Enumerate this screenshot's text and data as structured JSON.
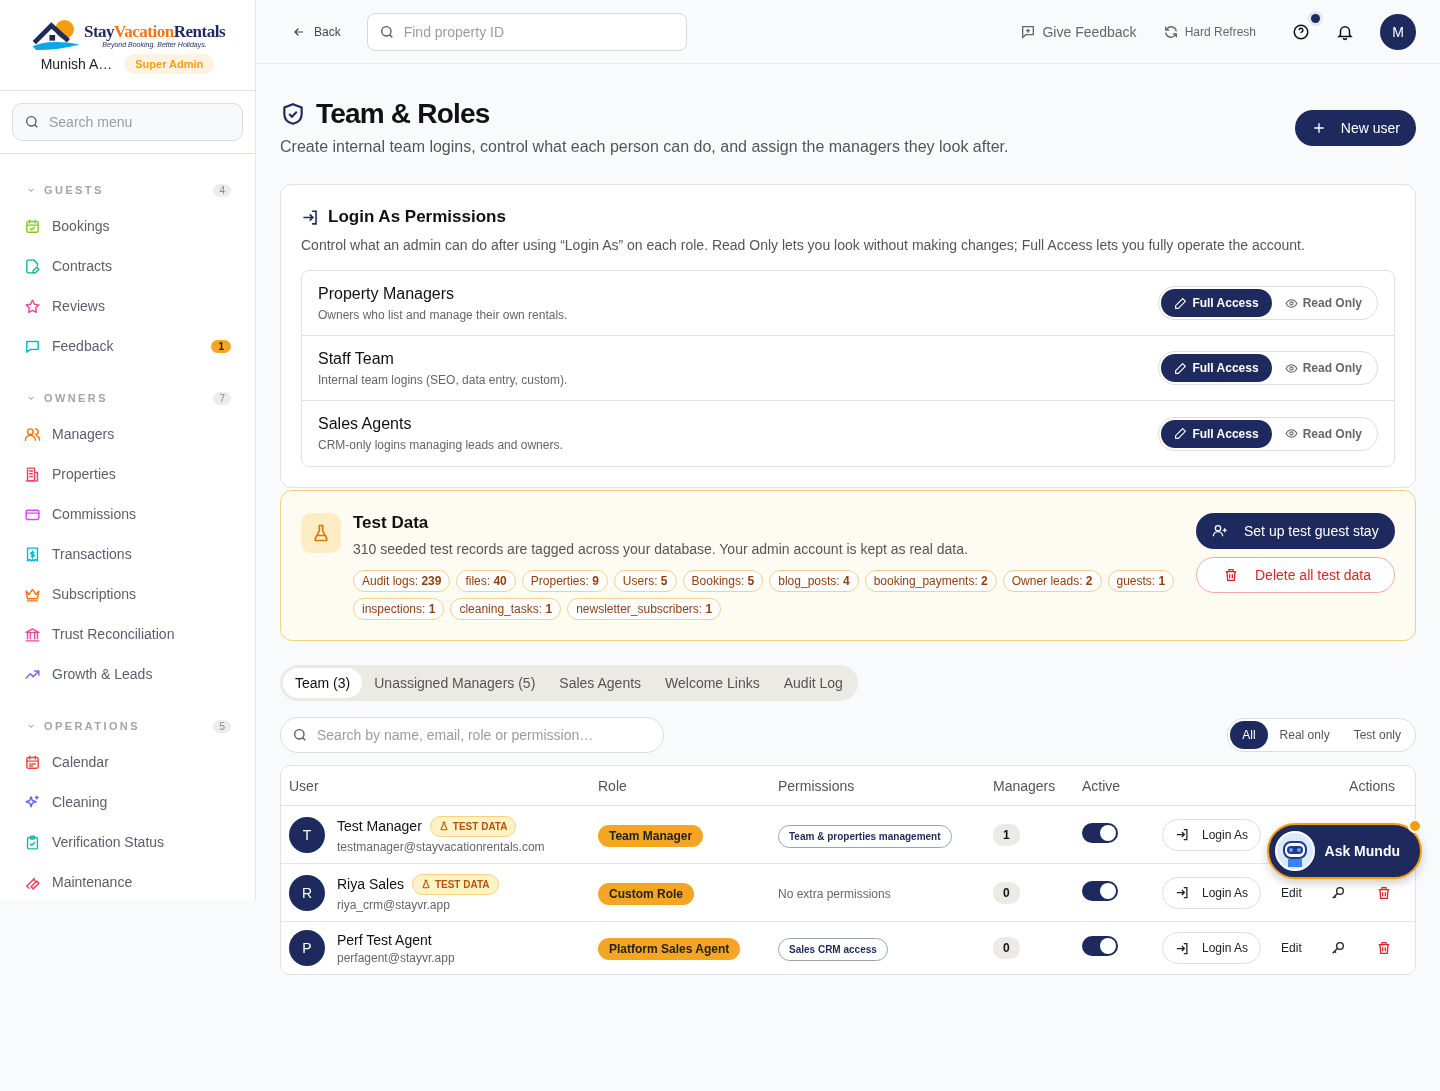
{
  "brand": {
    "word_1": "Stay",
    "word_2": "Vacation",
    "word_3": "Rentals",
    "tagline": "Beyond Booking. Better Holidays."
  },
  "user": {
    "name": "Munish A…",
    "role_badge": "Super Admin"
  },
  "sidebar": {
    "search_placeholder": "Search menu",
    "sections": [
      {
        "title": "GUESTS",
        "count": "4",
        "expanded": true,
        "items": [
          {
            "label": "Bookings"
          },
          {
            "label": "Contracts"
          },
          {
            "label": "Reviews"
          },
          {
            "label": "Feedback",
            "badge": "1"
          }
        ]
      },
      {
        "title": "OWNERS",
        "count": "7",
        "expanded": true,
        "items": [
          {
            "label": "Managers"
          },
          {
            "label": "Properties"
          },
          {
            "label": "Commissions"
          },
          {
            "label": "Transactions"
          },
          {
            "label": "Subscriptions"
          },
          {
            "label": "Trust Reconciliation"
          },
          {
            "label": "Growth & Leads"
          }
        ]
      },
      {
        "title": "OPERATIONS",
        "count": "5",
        "expanded": true,
        "items": [
          {
            "label": "Calendar"
          },
          {
            "label": "Cleaning"
          },
          {
            "label": "Verification Status"
          },
          {
            "label": "Maintenance"
          }
        ]
      }
    ]
  },
  "topbar": {
    "back": "Back",
    "search_placeholder": "Find property ID",
    "feedback": "Give Feedback",
    "refresh": "Hard Refresh",
    "help_unread": true,
    "avatar": "M"
  },
  "page": {
    "title": "Team & Roles",
    "subtitle": "Create internal team logins, control what each person can do, and assign the managers they look after.",
    "new_button": "New user"
  },
  "login_as": {
    "title": "Login As Permissions",
    "description": "Control what an admin can do after using “Login As” on each role. Read Only lets you look without making changes; Full Access lets you fully operate the account.",
    "roles": [
      {
        "name": "Property Managers",
        "description": "Owners who list and manage their own rentals.",
        "options": [
          {
            "kind": "full",
            "label": "Full Access",
            "selected": true
          },
          {
            "kind": "read",
            "label": "Read Only",
            "selected": false
          }
        ]
      },
      {
        "name": "Staff Team",
        "description": "Internal team logins (SEO, data entry, custom).",
        "options": [
          {
            "kind": "full",
            "label": "Full Access",
            "selected": true
          },
          {
            "kind": "read",
            "label": "Read Only",
            "selected": false
          }
        ]
      },
      {
        "name": "Sales Agents",
        "description": "CRM-only logins managing leads and owners.",
        "options": [
          {
            "kind": "full",
            "label": "Full Access",
            "selected": true
          },
          {
            "kind": "read",
            "label": "Read Only",
            "selected": false
          }
        ]
      }
    ]
  },
  "test_data": {
    "title": "Test Data",
    "description": "310 seeded test records are tagged across your database. Your admin account is kept as real data.",
    "chips": [
      "Audit logs: **239**",
      "files: **40**",
      "Properties: **9**",
      "Users: **5**",
      "Bookings: **5**",
      "blog_posts: **4**",
      "booking_payments: **2**",
      "Owner leads: **2**",
      "guests: **1**",
      "inspections: **1**",
      "cleaning_tasks: **1**",
      "newsletter_subscribers: **1**"
    ],
    "setup_button": "Set up test guest stay",
    "delete_button": "Delete all test data"
  },
  "tabs": [
    {
      "label": "Team (3)",
      "selected": true
    },
    {
      "label": "Unassigned Managers (5)",
      "selected": false
    },
    {
      "label": "Sales Agents",
      "selected": false
    },
    {
      "label": "Welcome Links",
      "selected": false
    },
    {
      "label": "Audit Log",
      "selected": false
    }
  ],
  "table_search_placeholder": "Search by name, email, role or permission…",
  "filters": [
    {
      "label": "All",
      "selected": true
    },
    {
      "label": "Real only",
      "selected": false
    },
    {
      "label": "Test only",
      "selected": false
    }
  ],
  "table": {
    "columns": [
      "User",
      "Role",
      "Permissions",
      "Managers",
      "Active",
      "Actions"
    ],
    "rows": [
      {
        "initial": "T",
        "name": "Test Manager",
        "test_badge": "TEST DATA",
        "email": "testmanager@stayvacationrentals.com",
        "role": "Team Manager",
        "permission": {
          "kind": "chip",
          "text": "Team & properties management"
        },
        "managers": "1",
        "active": true,
        "actions": [
          {
            "kind": "login",
            "label": "Login As"
          }
        ]
      },
      {
        "initial": "R",
        "name": "Riya Sales",
        "test_badge": "TEST DATA",
        "email": "riya_crm@stayvr.app",
        "role": "Custom Role",
        "permission": {
          "kind": "text",
          "text": "No extra permissions"
        },
        "managers": "0",
        "active": true,
        "actions": [
          {
            "kind": "login",
            "label": "Login As"
          },
          {
            "kind": "edit",
            "label": "Edit"
          },
          {
            "kind": "key"
          },
          {
            "kind": "delete"
          }
        ]
      },
      {
        "initial": "P",
        "name": "Perf Test Agent",
        "email": "perfagent@stayvr.app",
        "role": "Platform Sales Agent",
        "permission": {
          "kind": "chip",
          "text": "Sales CRM access"
        },
        "managers": "0",
        "active": true,
        "actions": [
          {
            "kind": "login",
            "label": "Login As"
          },
          {
            "kind": "edit",
            "label": "Edit"
          },
          {
            "kind": "key"
          },
          {
            "kind": "delete"
          }
        ]
      }
    ]
  },
  "assistant": {
    "label": "Ask Mundu",
    "unread": true
  }
}
